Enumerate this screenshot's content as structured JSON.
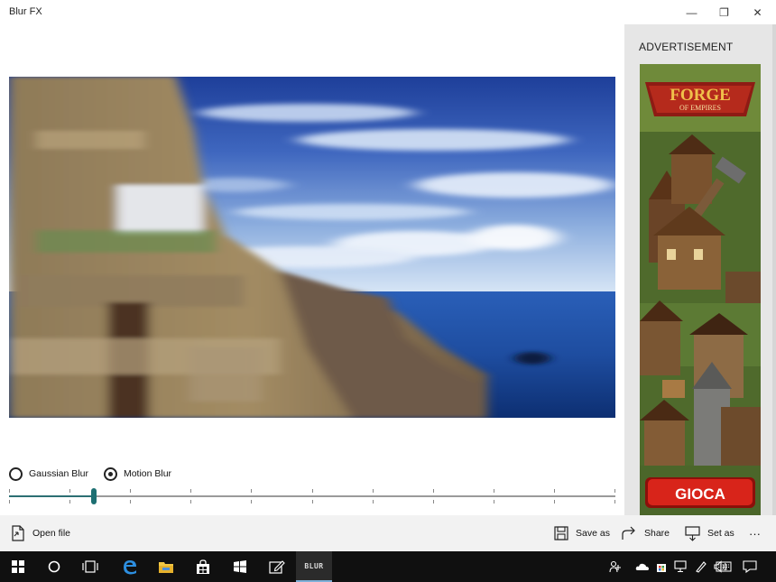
{
  "window": {
    "title": "Blur FX",
    "minimize_glyph": "—",
    "maximize_glyph": "❐",
    "close_glyph": "✕"
  },
  "editor": {
    "blur_options": [
      {
        "label": "Gaussian Blur",
        "selected": false
      },
      {
        "label": "Motion Blur",
        "selected": true
      }
    ],
    "slider": {
      "value": 0.14,
      "tick_count": 11
    },
    "accent_color": "#1d6f72"
  },
  "ad": {
    "label": "ADVERTISEMENT",
    "brand_line1": "FORGE",
    "brand_line2": "OF EMPIRES",
    "cta": "GIOCA"
  },
  "commands": {
    "open_file": "Open file",
    "save_as": "Save as",
    "share": "Share",
    "set_as": "Set as",
    "more": "···"
  },
  "taskbar": {
    "active_app_label": "BLUR",
    "icons": [
      "windows-start-icon",
      "cortana-icon",
      "task-view-icon",
      "edge-icon",
      "file-explorer-icon",
      "store-icon",
      "windows-icon",
      "edit-icon",
      "blur-fx-app-icon"
    ],
    "tray_icons": [
      "people-icon",
      "onedrive-icon",
      "store-badge-icon",
      "network-icon",
      "pen-icon",
      "volume-icon",
      "keyboard-icon",
      "action-center-icon"
    ]
  }
}
